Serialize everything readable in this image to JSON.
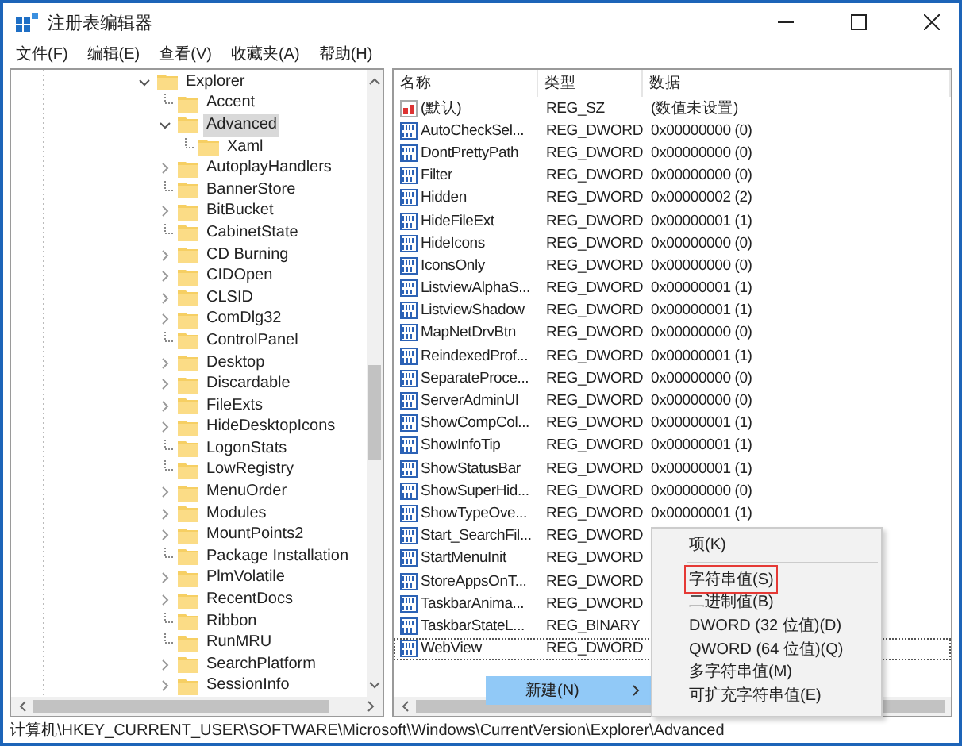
{
  "window": {
    "title": "注册表编辑器"
  },
  "menu_bar": [
    "文件(F)",
    "编辑(E)",
    "查看(V)",
    "收藏夹(A)",
    "帮助(H)"
  ],
  "tree": [
    {
      "label": "Explorer",
      "expandable": true,
      "expanded": true,
      "selected": false,
      "children": [
        {
          "label": "Accent",
          "expandable": false,
          "expanded": false,
          "selected": false
        },
        {
          "label": "Advanced",
          "expandable": true,
          "expanded": true,
          "selected": true,
          "children": [
            {
              "label": "Xaml",
              "expandable": false,
              "expanded": false,
              "selected": false
            }
          ]
        },
        {
          "label": "AutoplayHandlers",
          "expandable": true,
          "expanded": false,
          "selected": false
        },
        {
          "label": "BannerStore",
          "expandable": false,
          "expanded": false,
          "selected": false
        },
        {
          "label": "BitBucket",
          "expandable": true,
          "expanded": false,
          "selected": false
        },
        {
          "label": "CabinetState",
          "expandable": false,
          "expanded": false,
          "selected": false
        },
        {
          "label": "CD Burning",
          "expandable": true,
          "expanded": false,
          "selected": false
        },
        {
          "label": "CIDOpen",
          "expandable": true,
          "expanded": false,
          "selected": false
        },
        {
          "label": "CLSID",
          "expandable": true,
          "expanded": false,
          "selected": false
        },
        {
          "label": "ComDlg32",
          "expandable": true,
          "expanded": false,
          "selected": false
        },
        {
          "label": "ControlPanel",
          "expandable": false,
          "expanded": false,
          "selected": false
        },
        {
          "label": "Desktop",
          "expandable": true,
          "expanded": false,
          "selected": false
        },
        {
          "label": "Discardable",
          "expandable": true,
          "expanded": false,
          "selected": false
        },
        {
          "label": "FileExts",
          "expandable": true,
          "expanded": false,
          "selected": false
        },
        {
          "label": "HideDesktopIcons",
          "expandable": true,
          "expanded": false,
          "selected": false
        },
        {
          "label": "LogonStats",
          "expandable": false,
          "expanded": false,
          "selected": false
        },
        {
          "label": "LowRegistry",
          "expandable": false,
          "expanded": false,
          "selected": false
        },
        {
          "label": "MenuOrder",
          "expandable": true,
          "expanded": false,
          "selected": false
        },
        {
          "label": "Modules",
          "expandable": true,
          "expanded": false,
          "selected": false
        },
        {
          "label": "MountPoints2",
          "expandable": true,
          "expanded": false,
          "selected": false
        },
        {
          "label": "Package Installation",
          "expandable": false,
          "expanded": false,
          "selected": false
        },
        {
          "label": "PlmVolatile",
          "expandable": true,
          "expanded": false,
          "selected": false
        },
        {
          "label": "RecentDocs",
          "expandable": true,
          "expanded": false,
          "selected": false
        },
        {
          "label": "Ribbon",
          "expandable": false,
          "expanded": false,
          "selected": false
        },
        {
          "label": "RunMRU",
          "expandable": false,
          "expanded": false,
          "selected": false
        },
        {
          "label": "SearchPlatform",
          "expandable": true,
          "expanded": false,
          "selected": false
        },
        {
          "label": "SessionInfo",
          "expandable": true,
          "expanded": false,
          "selected": false
        }
      ]
    }
  ],
  "values": {
    "columns": [
      "名称",
      "类型",
      "数据"
    ],
    "rows": [
      {
        "kind": "string",
        "name": "(默认)",
        "type": "REG_SZ",
        "data": "(数值未设置)",
        "focused": false
      },
      {
        "kind": "number",
        "name": "AutoCheckSel...",
        "type": "REG_DWORD",
        "data": "0x00000000 (0)",
        "focused": false
      },
      {
        "kind": "number",
        "name": "DontPrettyPath",
        "type": "REG_DWORD",
        "data": "0x00000000 (0)",
        "focused": false
      },
      {
        "kind": "number",
        "name": "Filter",
        "type": "REG_DWORD",
        "data": "0x00000000 (0)",
        "focused": false
      },
      {
        "kind": "number",
        "name": "Hidden",
        "type": "REG_DWORD",
        "data": "0x00000002 (2)",
        "focused": false
      },
      {
        "kind": "number",
        "name": "HideFileExt",
        "type": "REG_DWORD",
        "data": "0x00000001 (1)",
        "focused": false
      },
      {
        "kind": "number",
        "name": "HideIcons",
        "type": "REG_DWORD",
        "data": "0x00000000 (0)",
        "focused": false
      },
      {
        "kind": "number",
        "name": "IconsOnly",
        "type": "REG_DWORD",
        "data": "0x00000000 (0)",
        "focused": false
      },
      {
        "kind": "number",
        "name": "ListviewAlphaS...",
        "type": "REG_DWORD",
        "data": "0x00000001 (1)",
        "focused": false
      },
      {
        "kind": "number",
        "name": "ListviewShadow",
        "type": "REG_DWORD",
        "data": "0x00000001 (1)",
        "focused": false
      },
      {
        "kind": "number",
        "name": "MapNetDrvBtn",
        "type": "REG_DWORD",
        "data": "0x00000000 (0)",
        "focused": false
      },
      {
        "kind": "number",
        "name": "ReindexedProf...",
        "type": "REG_DWORD",
        "data": "0x00000001 (1)",
        "focused": false
      },
      {
        "kind": "number",
        "name": "SeparateProce...",
        "type": "REG_DWORD",
        "data": "0x00000000 (0)",
        "focused": false
      },
      {
        "kind": "number",
        "name": "ServerAdminUI",
        "type": "REG_DWORD",
        "data": "0x00000000 (0)",
        "focused": false
      },
      {
        "kind": "number",
        "name": "ShowCompCol...",
        "type": "REG_DWORD",
        "data": "0x00000001 (1)",
        "focused": false
      },
      {
        "kind": "number",
        "name": "ShowInfoTip",
        "type": "REG_DWORD",
        "data": "0x00000001 (1)",
        "focused": false
      },
      {
        "kind": "number",
        "name": "ShowStatusBar",
        "type": "REG_DWORD",
        "data": "0x00000001 (1)",
        "focused": false
      },
      {
        "kind": "number",
        "name": "ShowSuperHid...",
        "type": "REG_DWORD",
        "data": "0x00000000 (0)",
        "focused": false
      },
      {
        "kind": "number",
        "name": "ShowTypeOve...",
        "type": "REG_DWORD",
        "data": "0x00000001 (1)",
        "focused": false
      },
      {
        "kind": "number",
        "name": "Start_SearchFil...",
        "type": "REG_DWORD",
        "focused": false
      },
      {
        "kind": "number",
        "name": "StartMenuInit",
        "type": "REG_DWORD",
        "focused": false
      },
      {
        "kind": "number",
        "name": "StoreAppsOnT...",
        "type": "REG_DWORD",
        "focused": false
      },
      {
        "kind": "number",
        "name": "TaskbarAnima...",
        "type": "REG_DWORD",
        "focused": false
      },
      {
        "kind": "number",
        "name": "TaskbarStateL...",
        "type": "REG_BINARY",
        "focused": false
      },
      {
        "kind": "number",
        "name": "WebView",
        "type": "REG_DWORD",
        "focused": true
      }
    ]
  },
  "context_menu": {
    "item": {
      "label": "新建(N)",
      "highlighted": true
    },
    "submenu": [
      {
        "kind": "item",
        "label": "项(K)",
        "outlined": false
      },
      {
        "kind": "separator"
      },
      {
        "kind": "item",
        "label": "字符串值(S)",
        "outlined": true
      },
      {
        "kind": "item",
        "label": "二进制值(B)",
        "outlined": false
      },
      {
        "kind": "item",
        "label": "DWORD (32 位值)(D)",
        "outlined": false
      },
      {
        "kind": "item",
        "label": "QWORD (64 位值)(Q)",
        "outlined": false
      },
      {
        "kind": "item",
        "label": "多字符串值(M)",
        "outlined": false
      },
      {
        "kind": "item",
        "label": "可扩充字符串值(E)",
        "outlined": false
      }
    ]
  },
  "status_bar": "计算机\\HKEY_CURRENT_USER\\SOFTWARE\\Microsoft\\Windows\\CurrentVersion\\Explorer\\Advanced"
}
